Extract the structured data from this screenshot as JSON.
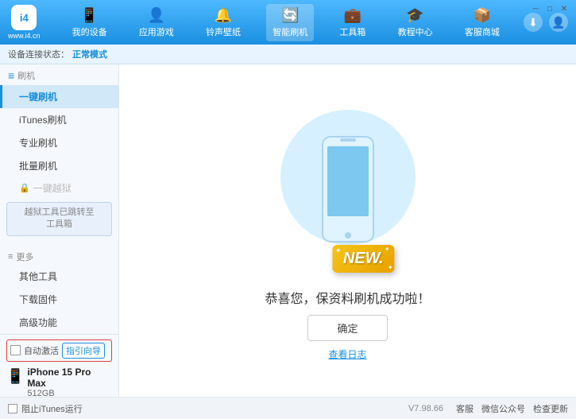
{
  "header": {
    "logo_char": "i4",
    "logo_url": "www.i4.cn",
    "nav_items": [
      {
        "id": "my-device",
        "label": "我的设备",
        "icon": "📱"
      },
      {
        "id": "apps-games",
        "label": "应用游戏",
        "icon": "👤"
      },
      {
        "id": "ringtone",
        "label": "铃声壁纸",
        "icon": "🔔"
      },
      {
        "id": "smart-flash",
        "label": "智能刷机",
        "icon": "🔄"
      },
      {
        "id": "toolbox",
        "label": "工具箱",
        "icon": "💼"
      },
      {
        "id": "tutorial",
        "label": "教程中心",
        "icon": "🎓"
      },
      {
        "id": "service",
        "label": "客服商城",
        "icon": "📦"
      }
    ]
  },
  "breadcrumb": {
    "prefix": "设备连接状态：",
    "status": "正常模式"
  },
  "sidebar": {
    "flash_section_label": "刷机",
    "items": [
      {
        "id": "one-key-flash",
        "label": "一键刷机",
        "active": true
      },
      {
        "id": "itunes-flash",
        "label": "iTunes刷机"
      },
      {
        "id": "pro-flash",
        "label": "专业刷机"
      },
      {
        "id": "batch-flash",
        "label": "批量刷机"
      }
    ],
    "disabled_item": "一键越狱",
    "note_line1": "越狱工具已跳转至",
    "note_line2": "工具箱",
    "more_label": "更多",
    "more_items": [
      {
        "id": "other-tools",
        "label": "其他工具"
      },
      {
        "id": "download-firmware",
        "label": "下载固件"
      },
      {
        "id": "advanced",
        "label": "高级功能"
      }
    ]
  },
  "device_panel": {
    "auto_activate_label": "自动激活",
    "guide_btn_label": "指引向导",
    "device_icon": "📱",
    "device_name": "iPhone 15 Pro Max",
    "device_storage": "512GB",
    "device_type": "iPhone"
  },
  "content": {
    "success_text": "恭喜您，保资料刷机成功啦！",
    "confirm_btn": "确定",
    "log_link": "查看日志",
    "new_label": "NEW."
  },
  "status_bar": {
    "no_itunes_label": "阻止iTunes运行",
    "version": "V7.98.66",
    "links": [
      "客服",
      "微信公众号",
      "检查更新"
    ]
  },
  "icons": {
    "download": "⬇",
    "account": "👤"
  }
}
